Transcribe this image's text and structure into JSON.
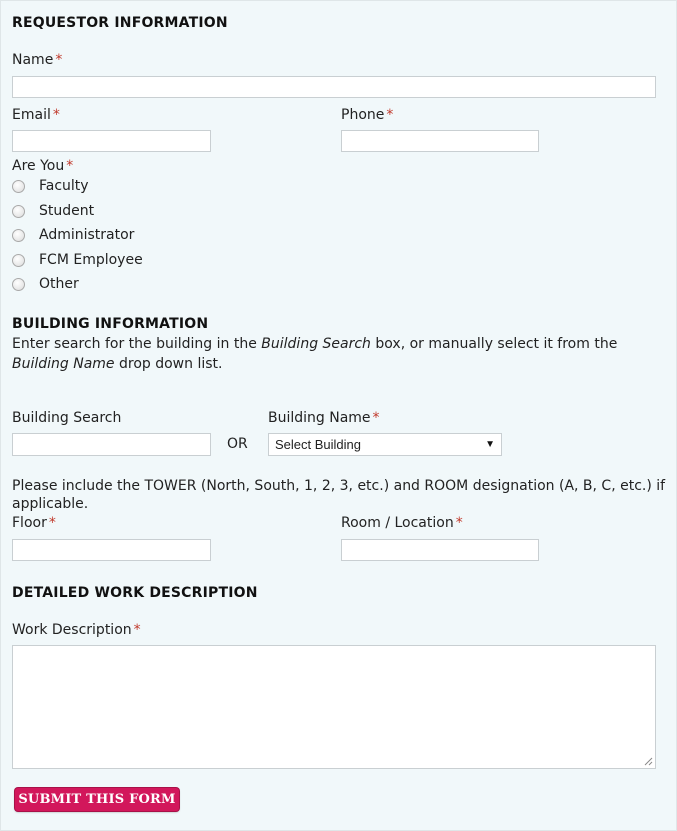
{
  "sections": {
    "requestor": "REQUESTOR INFORMATION",
    "building": "BUILDING INFORMATION",
    "work": "DETAILED WORK DESCRIPTION"
  },
  "required_mark": "*",
  "fields": {
    "name": {
      "label": "Name",
      "value": ""
    },
    "email": {
      "label": "Email",
      "value": ""
    },
    "phone": {
      "label": "Phone",
      "value": ""
    },
    "are_you": {
      "label": "Are You",
      "options": [
        "Faculty",
        "Student",
        "Administrator",
        "FCM Employee",
        "Other"
      ]
    },
    "building_search": {
      "label": "Building Search",
      "value": ""
    },
    "or_text": "OR",
    "building_name": {
      "label": "Building Name",
      "selected": "Select Building"
    },
    "floor": {
      "label": "Floor",
      "value": ""
    },
    "room": {
      "label": "Room / Location",
      "value": ""
    },
    "work_description": {
      "label": "Work Description",
      "value": ""
    }
  },
  "building_instructions": {
    "part1": "Enter search for the building in the ",
    "em1": "Building Search",
    "part2": " box, or manually select it from the ",
    "em2": "Building Name",
    "part3": " drop down list."
  },
  "tower_note": "Please include the TOWER (North, South, 1, 2, 3, etc.) and ROOM designation (A, B, C, etc.) if applicable.",
  "submit_label": "SUBMIT THIS FORM",
  "colors": {
    "background": "#f1f8fa",
    "required": "#c0392b",
    "submit": "#d2175b"
  }
}
